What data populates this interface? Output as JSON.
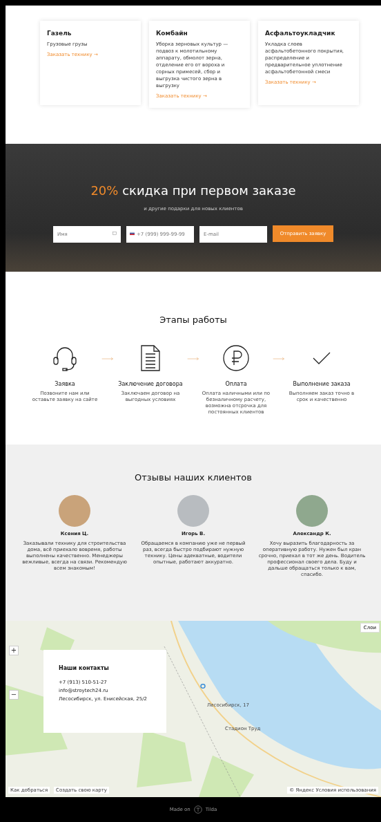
{
  "services": [
    {
      "title": "Газель",
      "text": "Грузовые грузы",
      "link": "Заказать технику →"
    },
    {
      "title": "Комбайн",
      "text": "Уборка зерновых культур — подвоз к молотильному аппарату, обмолот зерна, отделение его от вороха и сорных примесей, сбор и выгрузка чистого зерна в выгрузку",
      "link": "Заказать технику →"
    },
    {
      "title": "Асфальтоукладчик",
      "text": "Укладка слоев асфальтобетонного покрытия, распределение и предварительное уплотнение асфальтобетонной смеси",
      "link": "Заказать технику →"
    }
  ],
  "promo": {
    "accent": "20%",
    "title": "скидка при первом заказе",
    "subtitle": "и другие подарки для новых клиентов",
    "name_placeholder": "Имя",
    "phone_placeholder": "+7 (999) 999-99-99",
    "email_placeholder": "E-mail",
    "button": "Отправить заявку"
  },
  "steps": {
    "title": "Этапы работы",
    "items": [
      {
        "kind": "headset",
        "title": "Заявка",
        "text": "Позвоните нам или оставьте заявку на сайте"
      },
      {
        "kind": "document",
        "title": "Заключение договора",
        "text": "Заключаем договор на выгодных условиях"
      },
      {
        "kind": "ruble",
        "title": "Оплата",
        "text": "Оплата наличными или по безналичному расчету, возможна отсрочка для постоянных клиентов"
      },
      {
        "kind": "check",
        "title": "Выполнение заказа",
        "text": "Выполняем заказ точно в срок и качественно"
      }
    ]
  },
  "reviews": {
    "title": "Отзывы наших клиентов",
    "items": [
      {
        "name": "Ксения Ц.",
        "text": "Заказывали технику для строительства дома, всё приехало вовремя, работы выполнены качественно. Менеджеры вежливые, всегда на связи. Рекомендую всем знакомым!"
      },
      {
        "name": "Игорь В.",
        "text": "Обращаемся в компанию уже не первый раз, всегда быстро подбирают нужную технику. Цены адекватные, водители опытные, работают аккуратно."
      },
      {
        "name": "Александр К.",
        "text": "Хочу выразить благодарность за оперативную работу. Нужен был кран срочно, приехал в тот же день. Водитель профессионал своего дела. Буду и дальше обращаться только к вам, спасибо."
      }
    ]
  },
  "contacts": {
    "title": "Наши контакты",
    "phone": "+7 (913) 510-51-27",
    "email": "info@stroytech24.ru",
    "address": "Лесосибирск, ул. Енисейская, 25/2"
  },
  "map": {
    "zoom_in": "+",
    "zoom_out": "−",
    "layers": "Слои",
    "place_label": "Лесосибирск, 17",
    "station": "Стадион Труд",
    "route": "Как добраться",
    "create": "Создать свою карту",
    "copyright": "© Яндекс Условия использования"
  },
  "footer": {
    "made": "Made on",
    "brand": "Tilda"
  }
}
